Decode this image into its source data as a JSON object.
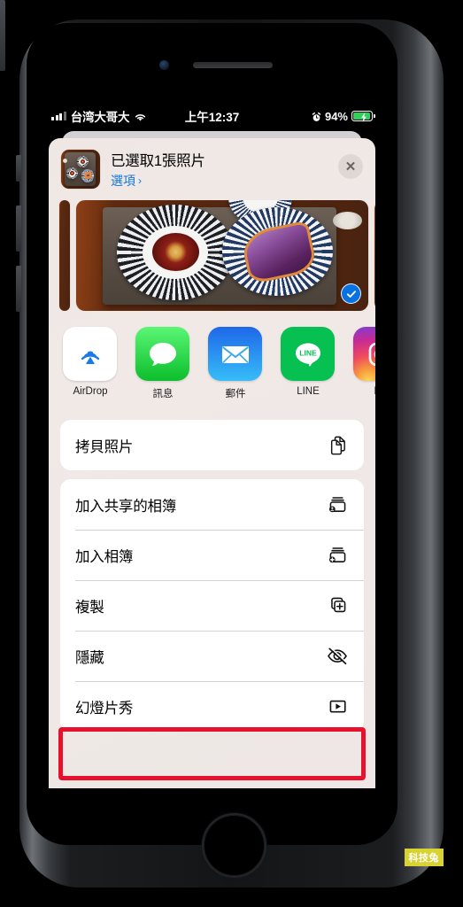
{
  "status_bar": {
    "carrier": "台湾大哥大",
    "time": "上午12:37",
    "battery_percent": "94%",
    "signal_icon": "cellular-signal-icon",
    "wifi_icon": "wifi-icon",
    "alarm_icon": "alarm-clock-icon",
    "battery_icon": "battery-charging-icon"
  },
  "share_sheet": {
    "header": {
      "title": "已選取1張照片",
      "options_label": "選項",
      "options_chevron": "›",
      "close_icon": "close-icon",
      "thumbnail_name": "selected-photo-thumbnail"
    },
    "photo_preview": {
      "selected_badge_icon": "checkmark-circle-icon",
      "alt": "照片：木盤上的甜點"
    },
    "apps": [
      {
        "label": "AirDrop",
        "icon": "airdrop-icon"
      },
      {
        "label": "訊息",
        "icon": "messages-icon"
      },
      {
        "label": "郵件",
        "icon": "mail-icon"
      },
      {
        "label": "LINE",
        "icon": "line-icon"
      },
      {
        "label": "Ins",
        "icon": "instagram-icon"
      }
    ],
    "action_groups": [
      {
        "rows": [
          {
            "label": "拷貝照片",
            "icon": "copy-icon",
            "highlighted": false
          }
        ]
      },
      {
        "rows": [
          {
            "label": "加入共享的相簿",
            "icon": "shared-album-icon",
            "highlighted": false
          },
          {
            "label": "加入相簿",
            "icon": "add-to-album-icon",
            "highlighted": false
          },
          {
            "label": "複製",
            "icon": "duplicate-icon",
            "highlighted": false
          },
          {
            "label": "隱藏",
            "icon": "hide-eye-slash-icon",
            "highlighted": true
          },
          {
            "label": "幻燈片秀",
            "icon": "slideshow-play-icon",
            "highlighted": false
          }
        ]
      }
    ]
  },
  "annotation": {
    "highlight_color": "#e8112d",
    "highlight_target": "隱藏"
  },
  "watermark": {
    "text": "科技兔",
    "background": "#d8d233"
  },
  "colors": {
    "link_blue": "#1175e2",
    "battery_green": "#30d158",
    "check_blue": "#0a72e0",
    "sheet_background": "#efe7e4"
  }
}
